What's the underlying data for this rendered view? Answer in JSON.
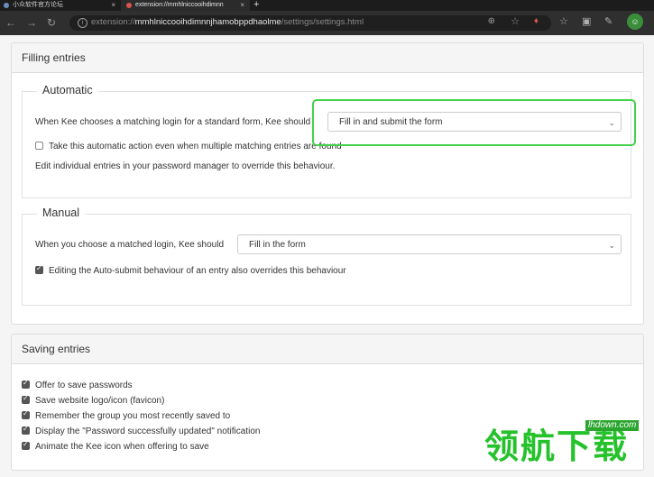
{
  "browser": {
    "tabs": [
      {
        "label": "小众软件官方论坛",
        "close": "×"
      },
      {
        "label": "extension://mmhlniccooihdimnn",
        "close": "×"
      }
    ],
    "new_tab": "+",
    "nav": {
      "back": "←",
      "forward": "→",
      "reload": "↻"
    },
    "url_prefix": "extension://",
    "url_host": "mmhlniccooihdimnnjhamobppdhaolme",
    "url_path": "/settings/settings.html"
  },
  "filling": {
    "title": "Filling entries",
    "automatic": {
      "legend": "Automatic",
      "label": "When Kee chooses a matching login for a standard form, Kee should",
      "select_value": "Fill in and submit the form",
      "checkbox_label": "Take this automatic action even when multiple matching entries are found",
      "checkbox_checked": false,
      "note": "Edit individual entries in your password manager to override this behaviour."
    },
    "manual": {
      "legend": "Manual",
      "label": "When you choose a matched login, Kee should",
      "select_value": "Fill in the form",
      "checkbox_label": "Editing the Auto-submit behaviour of an entry also overrides this behaviour",
      "checkbox_checked": true
    }
  },
  "saving": {
    "title": "Saving entries",
    "options": [
      {
        "label": "Offer to save passwords",
        "checked": true
      },
      {
        "label": "Save website logo/icon (favicon)",
        "checked": true
      },
      {
        "label": "Remember the group you most recently saved to",
        "checked": true
      },
      {
        "label": "Display the \"Password successfully updated\" notification",
        "checked": true
      },
      {
        "label": "Animate the Kee icon when offering to save",
        "checked": true
      }
    ]
  },
  "watermark": {
    "main": "领航下载",
    "sub": "lhdown.com"
  },
  "colors": {
    "highlight": "#43d14a",
    "watermark": "#25c22b"
  }
}
